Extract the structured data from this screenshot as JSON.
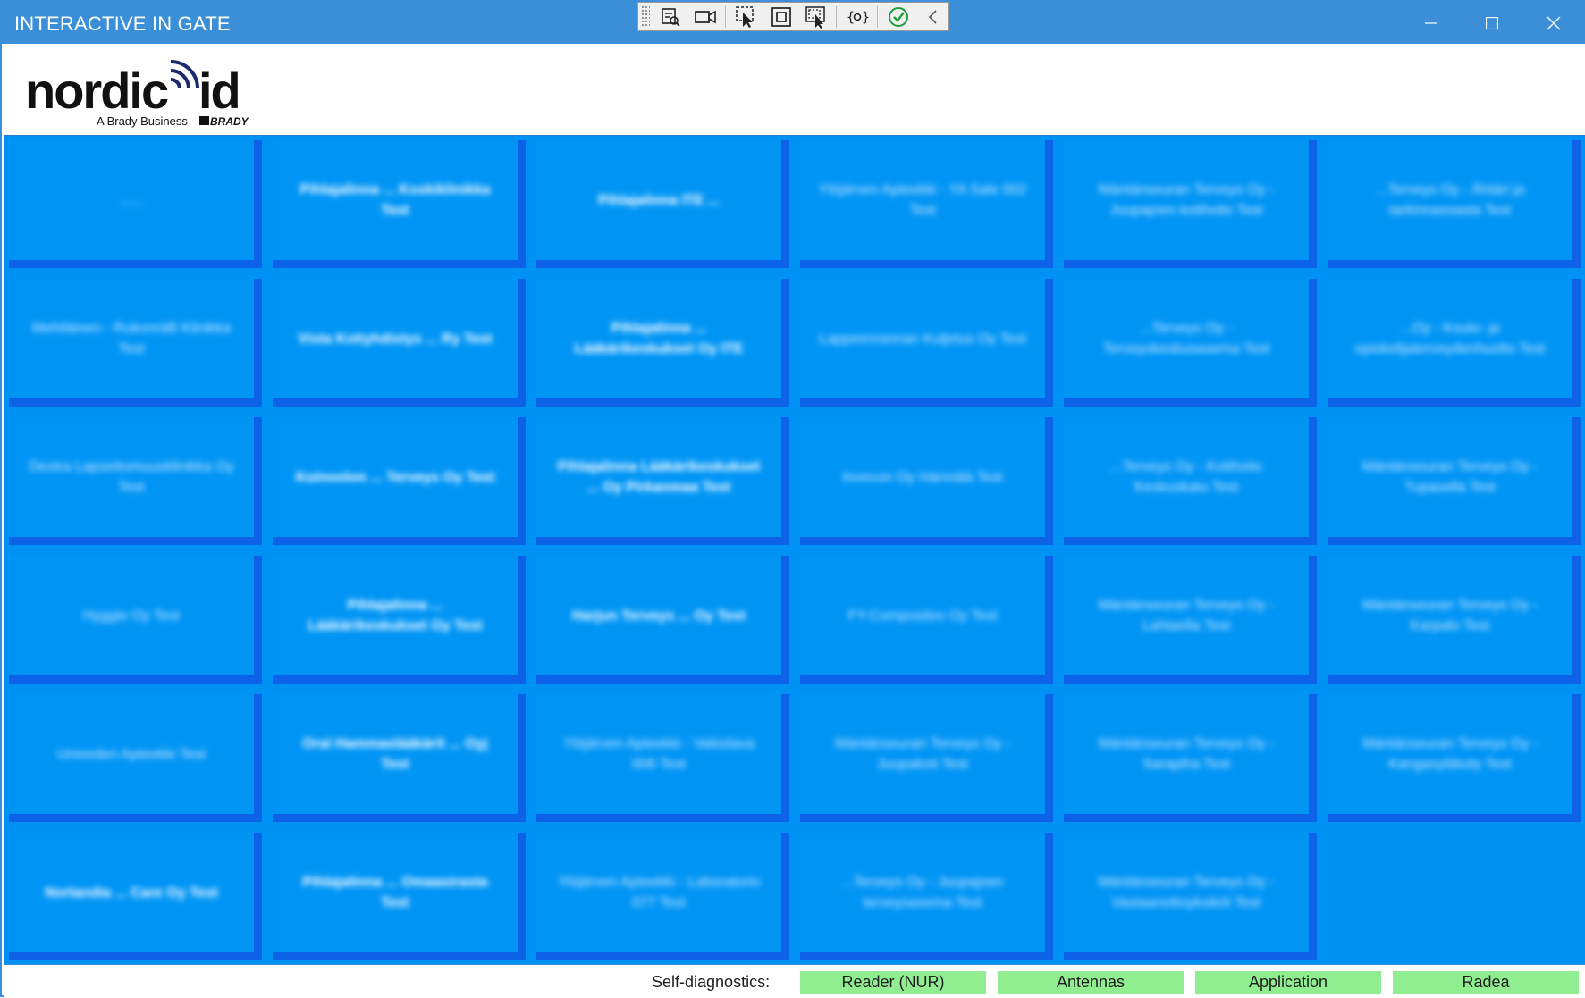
{
  "window": {
    "title": "INTERACTIVE IN GATE",
    "controls": {
      "minimize": "—",
      "maximize": "☐",
      "close": "✕"
    }
  },
  "devtools": {
    "buttons": [
      "live-visual-tree-icon",
      "record-icon",
      "select-element-icon",
      "display-layout-adorners-icon",
      "track-focused-element-icon",
      "binding-failures-icon",
      "hot-reload-ok-icon",
      "collapse-toolbar-icon"
    ]
  },
  "header": {
    "logo": {
      "wordmark": "nordic id",
      "tagline": "A Brady Business",
      "brand": "BRADY"
    }
  },
  "tiles": [
    {
      "label": "......",
      "bold": false
    },
    {
      "label": "Pihlajalinna ... Koskiklinikka Test",
      "bold": true
    },
    {
      "label": "Pihlajalinna ITE ...",
      "bold": true
    },
    {
      "label": "Ylöjärven Apteekki - YA Sale 002 Test",
      "bold": false
    },
    {
      "label": "Mäntänseuran Terveys Oy - Juupajoen kotihoito Test",
      "bold": false
    },
    {
      "label": "...Terveys Oy - Ähtäri ja tarkinnassasta Test",
      "bold": false
    },
    {
      "label": "Mehiläinen - Rukonrälli Klinikka Test",
      "bold": false
    },
    {
      "label": "Vista Kotiyhdistys ... Ry Test",
      "bold": true
    },
    {
      "label": "Pihlajalinna ... Lääkärikeskukset Oy ITE",
      "bold": true
    },
    {
      "label": "Lappeenrannan Kuljetus Oy Test",
      "bold": false
    },
    {
      "label": "...Terveys Oy - Terveyskeskusasema Test",
      "bold": false
    },
    {
      "label": "...Oy - Koulu- ja opiskelijaterveydenhuolto Test",
      "bold": false
    },
    {
      "label": "Dextra Lapsettomuusklinikka Oy Test",
      "bold": false
    },
    {
      "label": "Kuinoolon ... Terveys Oy Test",
      "bold": true
    },
    {
      "label": "Pihlajalinna Lääkärikeskukset ... Oy Pirkanmaa Test",
      "bold": true
    },
    {
      "label": "Invecon Oy Härmälä Test",
      "bold": false
    },
    {
      "label": "...Terveys Oy - Kotihoito Keskuskatu Test",
      "bold": false
    },
    {
      "label": "Mäntänseuran Terveys Oy - Tupasella Test",
      "bold": false
    },
    {
      "label": "Hyggie Oy Test",
      "bold": false
    },
    {
      "label": "Pihlajalinna ... Lääkärikeskukset Oy Test",
      "bold": true
    },
    {
      "label": "Harjun Terveys ... Oy Test",
      "bold": true
    },
    {
      "label": "FY-Composites Oy Test",
      "bold": false
    },
    {
      "label": "Mäntänseuran Terveys Oy - Lahtaella Test",
      "bold": false
    },
    {
      "label": "Mäntänseuran Terveys Oy - Karpalo Test",
      "bold": false
    },
    {
      "label": "Univeden Apteekki Test",
      "bold": false
    },
    {
      "label": "Oral Hammaslääkärit ... Oyj Test",
      "bold": true
    },
    {
      "label": "Ylöjärven Apteekki - Vakiolava 006 Test",
      "bold": false
    },
    {
      "label": "Mäntänseuran Terveys Oy - Juupakoti Test",
      "bold": false
    },
    {
      "label": "Mäntänseuran Terveys Oy - Sarapiha Test",
      "bold": false
    },
    {
      "label": "Mäntänseuran Terveys Oy - Kangasyläkoty Test",
      "bold": false
    },
    {
      "label": "Norlandia ... Care Oy Test",
      "bold": true
    },
    {
      "label": "Pihlajalinna ... Omaasirasta Test",
      "bold": true
    },
    {
      "label": "Ylöjärven Apteekki - Laboratorio 077 Test",
      "bold": false
    },
    {
      "label": "...Terveys Oy - Juupajoen terveysasema Test",
      "bold": false
    },
    {
      "label": "Mäntänseuran Terveys Oy - Vastaanottoyksiköt Test",
      "bold": false
    }
  ],
  "footer": {
    "label": "Self-diagnostics:",
    "statuses": [
      {
        "label": "Reader (NUR)",
        "state": "ok"
      },
      {
        "label": "Antennas",
        "state": "ok"
      },
      {
        "label": "Application",
        "state": "ok"
      },
      {
        "label": "Radea",
        "state": "ok"
      }
    ],
    "ok_color": "#90ee90"
  },
  "colors": {
    "titlebar": "#3a8fd8",
    "tile": "#0095f5",
    "tile_shadow": "#0d62e8"
  }
}
